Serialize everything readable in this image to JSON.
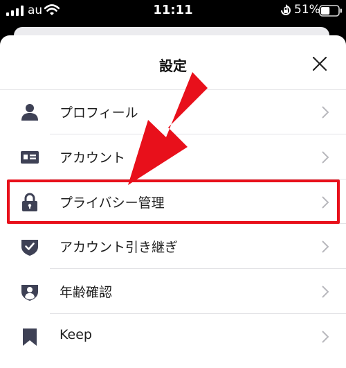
{
  "status_bar": {
    "carrier": "au",
    "time": "11:11",
    "battery": "51%",
    "battery_level": 0.51
  },
  "settings": {
    "title": "設定",
    "items": [
      {
        "label": "プロフィール",
        "icon": "person-icon"
      },
      {
        "label": "アカウント",
        "icon": "id-card-icon"
      },
      {
        "label": "プライバシー管理",
        "icon": "lock-icon",
        "highlighted": true
      },
      {
        "label": "アカウント引き継ぎ",
        "icon": "shield-check-icon"
      },
      {
        "label": "年齢確認",
        "icon": "shield-person-icon"
      },
      {
        "label": "Keep",
        "icon": "bookmark-icon"
      }
    ]
  },
  "colors": {
    "icon": "#3e4155",
    "chevron": "#b8b8bd",
    "annotation": "#e8101b"
  }
}
